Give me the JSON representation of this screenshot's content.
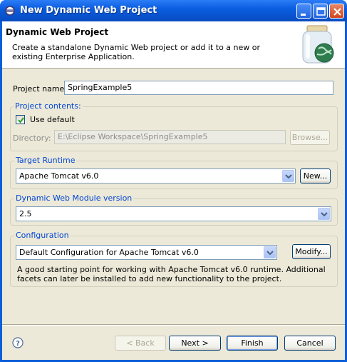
{
  "window": {
    "title": "New Dynamic Web Project",
    "app_icon": "eclipse-icon",
    "controls": [
      "minimize-icon",
      "maximize-icon",
      "close-icon"
    ]
  },
  "banner": {
    "title": "Dynamic Web Project",
    "description": "Create a standalone Dynamic Web project or add it to a new or existing Enterprise Application.",
    "icon": "web-project-jar-icon"
  },
  "form": {
    "project_name_label": "Project name:",
    "project_name_value": "SpringExample5",
    "project_contents": {
      "title": "Project contents:",
      "use_default_label": "Use default",
      "use_default_checked": true,
      "directory_label": "Directory:",
      "directory_value": "E:\\Eclipse Workspace\\SpringExample5",
      "browse_label": "Browse..."
    },
    "target_runtime": {
      "title": "Target Runtime",
      "selected": "Apache Tomcat v6.0",
      "new_label": "New..."
    },
    "module_version": {
      "title": "Dynamic Web Module version",
      "selected": "2.5"
    },
    "configuration": {
      "title": "Configuration",
      "selected": "Default Configuration for Apache Tomcat v6.0",
      "modify_label": "Modify...",
      "description": "A good starting point for working with Apache Tomcat v6.0 runtime. Additional facets can later be installed to add new functionality to the project."
    }
  },
  "footer": {
    "help_icon": "help-icon",
    "back_label": "< Back",
    "next_label": "Next >",
    "finish_label": "Finish",
    "cancel_label": "Cancel"
  },
  "colors": {
    "titlebar": "#0a5fd8",
    "dialog_bg": "#ece9d8",
    "group_title": "#0046d5"
  }
}
